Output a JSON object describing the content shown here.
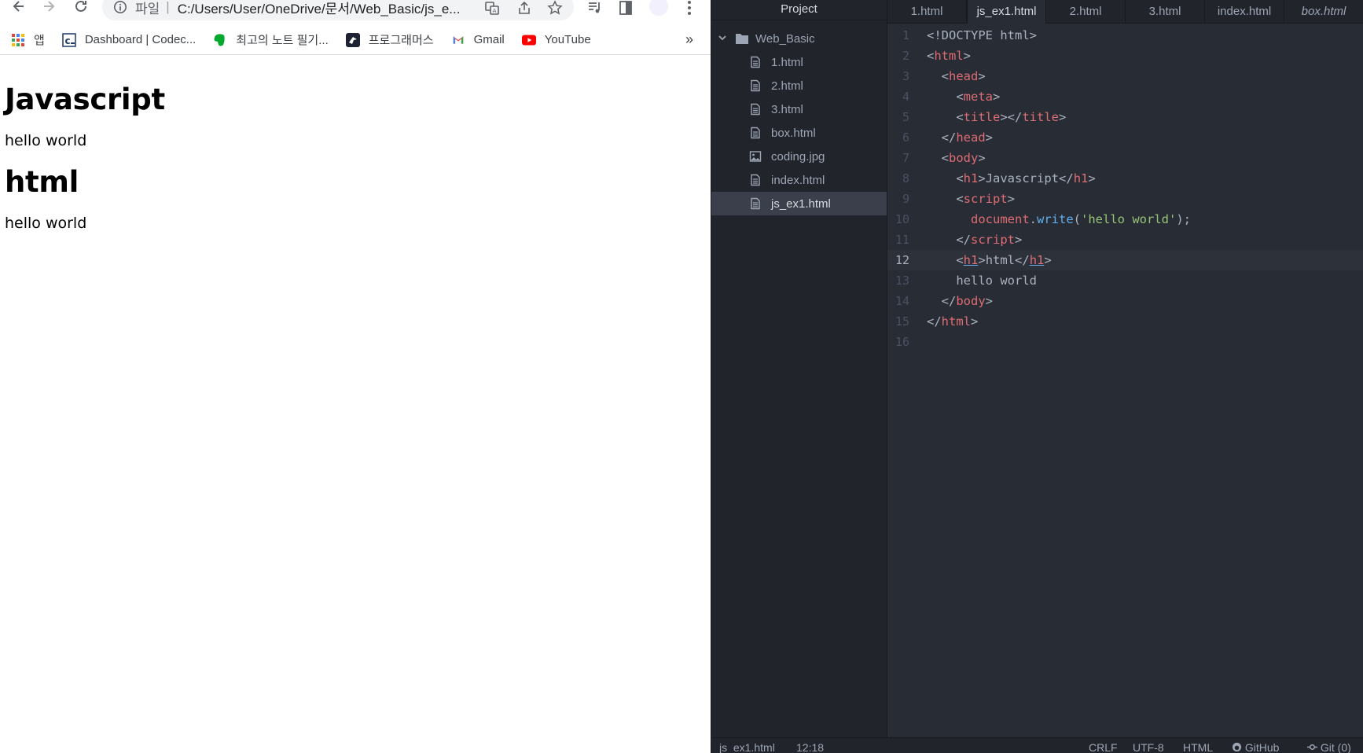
{
  "browser": {
    "omnibox": {
      "scheme_label": "파일",
      "separator": "|",
      "url": "C:/Users/User/OneDrive/문서/Web_Basic/js_e..."
    },
    "bookmarks": [
      {
        "label": "앱",
        "icon": "apps-grid-icon"
      },
      {
        "label": "Dashboard | Codec...",
        "icon": "codecademy-icon"
      },
      {
        "label": "최고의 노트 필기...",
        "icon": "evernote-icon"
      },
      {
        "label": "프로그래머스",
        "icon": "programmers-icon"
      },
      {
        "label": "Gmail",
        "icon": "gmail-icon"
      },
      {
        "label": "YouTube",
        "icon": "youtube-icon"
      }
    ],
    "bookmarks_more": "»",
    "page": {
      "h1_first": "Javascript",
      "text_first": "hello world",
      "h1_second": "html",
      "text_second": "hello world"
    }
  },
  "editor": {
    "tree_header": "Project",
    "root_folder": "Web_Basic",
    "files": [
      {
        "name": "1.html",
        "type": "file"
      },
      {
        "name": "2.html",
        "type": "file"
      },
      {
        "name": "3.html",
        "type": "file"
      },
      {
        "name": "box.html",
        "type": "file"
      },
      {
        "name": "coding.jpg",
        "type": "image"
      },
      {
        "name": "index.html",
        "type": "file"
      },
      {
        "name": "js_ex1.html",
        "type": "file",
        "selected": true
      }
    ],
    "tabs": [
      {
        "label": "1.html"
      },
      {
        "label": "js_ex1.html",
        "active": true
      },
      {
        "label": "2.html"
      },
      {
        "label": "3.html"
      },
      {
        "label": "index.html"
      },
      {
        "label": "box.html",
        "preview": true
      }
    ],
    "code_lines": [
      {
        "n": "1"
      },
      {
        "n": "2"
      },
      {
        "n": "3"
      },
      {
        "n": "4"
      },
      {
        "n": "5"
      },
      {
        "n": "6"
      },
      {
        "n": "7"
      },
      {
        "n": "8"
      },
      {
        "n": "9"
      },
      {
        "n": "10"
      },
      {
        "n": "11"
      },
      {
        "n": "12"
      },
      {
        "n": "13"
      },
      {
        "n": "14"
      },
      {
        "n": "15"
      },
      {
        "n": "16"
      }
    ],
    "cursor_line": 12,
    "status": {
      "file": "js_ex1.html",
      "position": "12:18",
      "line_ending": "CRLF",
      "encoding": "UTF-8",
      "grammar": "HTML",
      "github": "GitHub",
      "git": "Git (0)"
    }
  }
}
